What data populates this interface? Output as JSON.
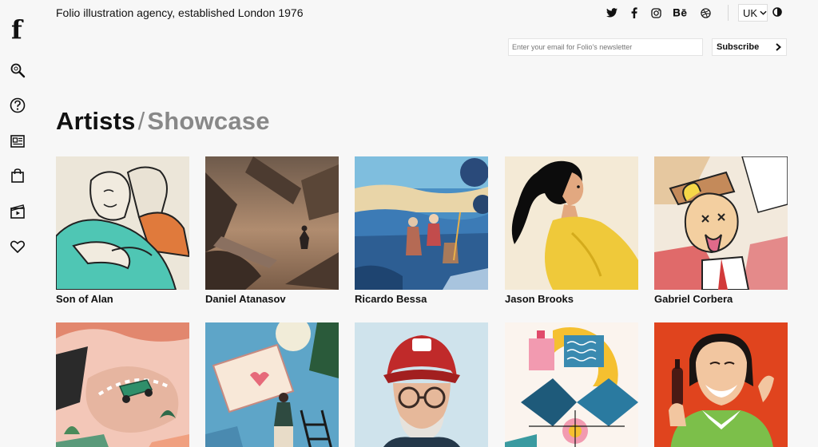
{
  "header": {
    "logo": "f",
    "tagline": "Folio illustration agency, established London 1976",
    "region": "UK"
  },
  "newsletter": {
    "placeholder": "Enter your email for Folio's newsletter",
    "button_label": "Subscribe"
  },
  "heading": {
    "primary": "Artists",
    "separator": "/",
    "secondary": "Showcase"
  },
  "social_icons": [
    "twitter-icon",
    "facebook-icon",
    "instagram-icon",
    "behance-icon",
    "dribbble-icon"
  ],
  "sidebar_icons": [
    "search-icon",
    "help-icon",
    "news-icon",
    "shop-icon",
    "video-icon",
    "favourites-icon"
  ],
  "artists": [
    {
      "name": "Son of Alan"
    },
    {
      "name": "Daniel Atanasov"
    },
    {
      "name": "Ricardo Bessa"
    },
    {
      "name": "Jason Brooks"
    },
    {
      "name": "Gabriel Corbera"
    }
  ],
  "colors": {
    "background": "#f7f7f7",
    "text": "#111111",
    "muted": "#888888"
  }
}
